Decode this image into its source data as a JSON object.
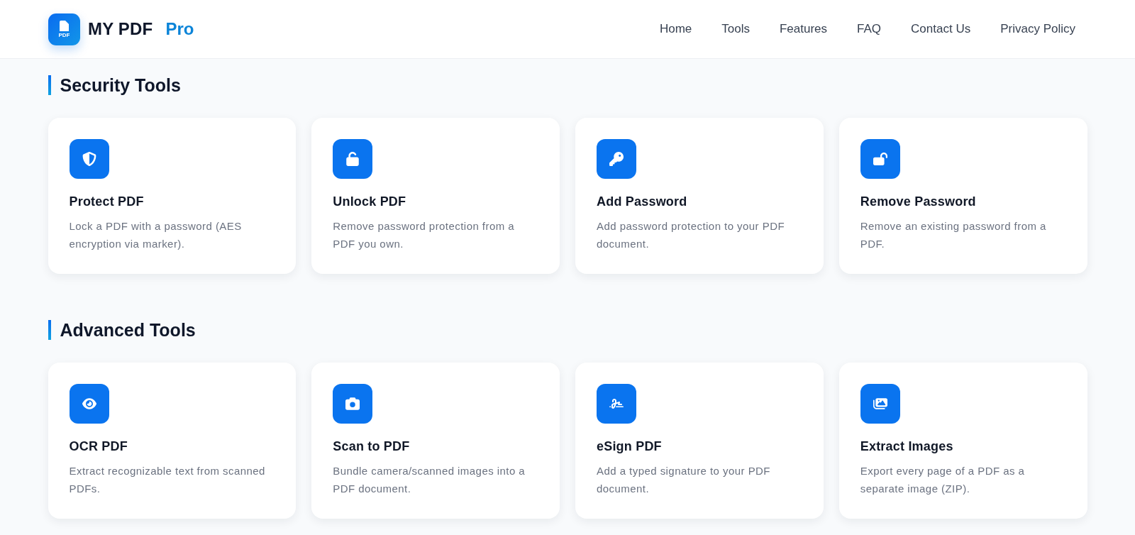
{
  "header": {
    "logo": {
      "badge": "PDF",
      "name": "MY PDF",
      "suffix": "Pro"
    },
    "nav": [
      "Home",
      "Tools",
      "Features",
      "FAQ",
      "Contact Us",
      "Privacy Policy"
    ]
  },
  "sections": [
    {
      "title": "Security Tools",
      "tools": [
        {
          "title": "Protect PDF",
          "description": "Lock a PDF with a password (AES encryption via marker)."
        },
        {
          "title": "Unlock PDF",
          "description": "Remove password protection from a PDF you own."
        },
        {
          "title": "Add Password",
          "description": "Add password protection to your PDF document."
        },
        {
          "title": "Remove Password",
          "description": "Remove an existing password from a PDF."
        }
      ]
    },
    {
      "title": "Advanced Tools",
      "tools": [
        {
          "title": "OCR PDF",
          "description": "Extract recognizable text from scanned PDFs."
        },
        {
          "title": "Scan to PDF",
          "description": "Bundle camera/scanned images into a PDF document."
        },
        {
          "title": "eSign PDF",
          "description": "Add a typed signature to your PDF document."
        },
        {
          "title": "Extract Images",
          "description": "Export every page of a PDF as a separate image (ZIP)."
        }
      ]
    }
  ]
}
